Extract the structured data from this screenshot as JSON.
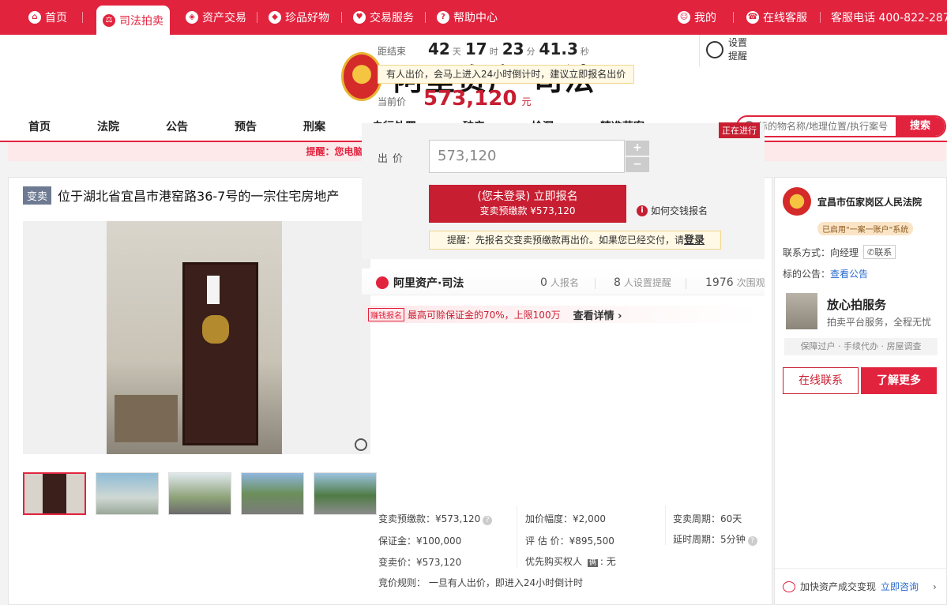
{
  "topbar": {
    "items": [
      {
        "label": "首页",
        "icon": "home-icon"
      },
      {
        "label": "司法拍卖",
        "icon": "gavel-icon"
      },
      {
        "label": "资产交易",
        "icon": "asset-icon"
      },
      {
        "label": "珍品好物",
        "icon": "gem-icon"
      },
      {
        "label": "交易服务",
        "icon": "heart-icon"
      },
      {
        "label": "帮助中心",
        "icon": "help-icon"
      }
    ],
    "my": "我的",
    "service": "在线客服",
    "hotline": "客服电话 400-822-2870"
  },
  "logo": {
    "text": "阿里资产·司法"
  },
  "mainnav": [
    "首页",
    "法院",
    "公告",
    "预告",
    "刑案",
    "自行处置",
    "破产",
    "捡漏",
    "精准获客"
  ],
  "search": {
    "placeholder": "标的物名称/地理位置/执行案号",
    "button": "搜索"
  },
  "notice": "提醒：您电脑时间和拍卖时间不一致，为避免错过合理的出价时间，请尽早出价！",
  "item": {
    "badge": "变卖",
    "title": "位于湖北省宜昌市港窑路36-7号的一宗住宅房地产"
  },
  "countdown": {
    "label": "距结束",
    "days": "42",
    "days_unit": "天",
    "hours": "17",
    "hours_unit": "时",
    "minutes": "23",
    "minutes_unit": "分",
    "seconds": "41.3",
    "seconds_unit": "秒"
  },
  "remind": {
    "label": "设置提醒"
  },
  "bid_tip": "有人出价，会马上进入24小时倒计时，建议立即报名出价",
  "current_price": {
    "label": "当前价",
    "value": "573,120",
    "unit": "元"
  },
  "status": "正在进行",
  "bid": {
    "label": "出价",
    "value": "573,120",
    "plus": "+",
    "minus": "−",
    "signup_line1": "(您未登录) 立即报名",
    "signup_line2": "变卖预缴款 ¥573,120",
    "howto": "如何交钱报名",
    "login_tip": "提醒：先报名交变卖预缴款再出价。如果您已经交付，请",
    "login_link": "登录"
  },
  "stats": {
    "brand": "阿里资产·司法",
    "signups": "0",
    "signups_label": "人报名",
    "reminders": "8",
    "reminders_label": "人设置提醒",
    "views": "1976",
    "views_label": "次围观"
  },
  "promo": {
    "tag": "赚钱报名",
    "text": "最高可赊保证金的70%，上限100万",
    "more": "查看详情 ›"
  },
  "details": {
    "deposit": "变卖预缴款：¥573,120",
    "increment": "加价幅度：¥2,000",
    "period": "变卖周期：60天",
    "margin": "保证金：¥100,000",
    "appraisal": "评 估 价：¥895,500",
    "delay": "延时周期：5分钟",
    "sale_price": "变卖价：¥573,120",
    "priority": "优先购买权人",
    "priority_value": "无",
    "priority_badge": "俩",
    "rule": "竞价规则：  一旦有人出价，即进入24小时倒计时"
  },
  "court": {
    "name": "宜昌市伍家岗区人民法院",
    "account": "已启用\"一案一账户\"系统",
    "contact_label": "联系方式：",
    "contact_name": "向经理",
    "contact_chip": "联系",
    "notice_label": "标的公告：",
    "notice_link": "查看公告"
  },
  "service": {
    "title": "放心拍服务",
    "subtitle": "拍卖平台服务，全程无忧",
    "bar": "保障过户 · 手续代办 · 房屋调查",
    "btn_contact": "在线联系",
    "btn_more": "了解更多"
  },
  "footer": {
    "text": "加快资产成交变现",
    "link": "立即咨询",
    "chevron": "›"
  }
}
